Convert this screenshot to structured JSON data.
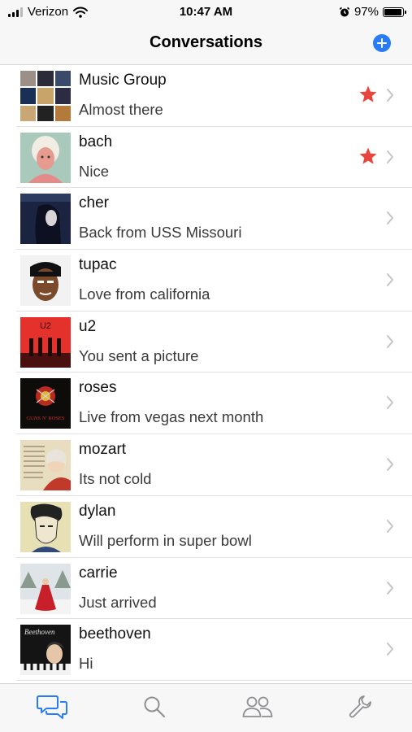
{
  "status_bar": {
    "carrier": "Verizon",
    "time": "10:47 AM",
    "battery": "97%",
    "battery_level": 0.97
  },
  "nav": {
    "title": "Conversations",
    "add_icon": "plus-circle-icon"
  },
  "colors": {
    "accent": "#2a7cf6",
    "star": "#e8463d",
    "chevron": "#c4c4c9"
  },
  "conversations": [
    {
      "name": "Music Group",
      "message": "Almost there",
      "starred": true,
      "avatar": "music-group-collage"
    },
    {
      "name": "bach",
      "message": "Nice",
      "starred": true,
      "avatar": "bach-portrait"
    },
    {
      "name": "cher",
      "message": "Back from USS Missouri",
      "starred": false,
      "avatar": "cher-album-cover"
    },
    {
      "name": "tupac",
      "message": "Love from california",
      "starred": false,
      "avatar": "tupac-portrait"
    },
    {
      "name": "u2",
      "message": "You sent a picture",
      "starred": false,
      "avatar": "u2-album-cover"
    },
    {
      "name": "roses",
      "message": "Live from vegas next month",
      "starred": false,
      "avatar": "guns-n-roses-album-cover"
    },
    {
      "name": "mozart",
      "message": "Its not cold",
      "starred": false,
      "avatar": "mozart-portrait"
    },
    {
      "name": "dylan",
      "message": "Will perform in super bowl",
      "starred": false,
      "avatar": "dylan-portrait"
    },
    {
      "name": "carrie",
      "message": "Just arrived",
      "starred": false,
      "avatar": "carrie-album-cover"
    },
    {
      "name": "beethoven",
      "message": "Hi",
      "starred": false,
      "avatar": "beethoven-album-cover"
    }
  ],
  "u2_cover_text": "U2",
  "roses_cover_text": "GUNS N' ROSES",
  "beethoven_cover_text": "Beethoven",
  "tabs": [
    {
      "name": "conversations",
      "icon": "chat-bubbles-icon",
      "active": true
    },
    {
      "name": "search",
      "icon": "search-icon",
      "active": false
    },
    {
      "name": "contacts",
      "icon": "people-icon",
      "active": false
    },
    {
      "name": "settings",
      "icon": "wrench-icon",
      "active": false
    }
  ]
}
